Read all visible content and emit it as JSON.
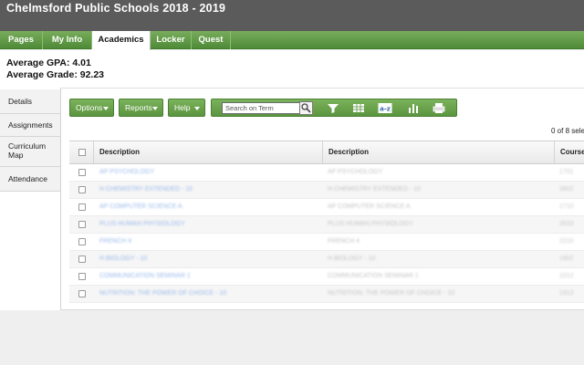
{
  "header": {
    "title": "Chelmsford Public Schools 2018 - 2019"
  },
  "nav": {
    "tabs": [
      {
        "label": "Pages",
        "active": false
      },
      {
        "label": "My Info",
        "active": false
      },
      {
        "label": "Academics",
        "active": true
      },
      {
        "label": "Locker",
        "active": false
      },
      {
        "label": "Quest",
        "active": false
      }
    ]
  },
  "summary": {
    "gpa": "Average GPA: 4.01",
    "grade": "Average Grade: 92.23"
  },
  "sidebar": {
    "items": [
      {
        "label": "Details"
      },
      {
        "label": "Assignments"
      },
      {
        "label": "Curriculum Map"
      },
      {
        "label": "Attendance"
      }
    ]
  },
  "toolbar": {
    "options_label": "Options",
    "reports_label": "Reports",
    "help_label": "Help",
    "search_placeholder": "Search on Term",
    "icons": [
      "search-icon",
      "filter-icon",
      "grid-icon",
      "sort-az-icon",
      "chart-icon",
      "print-icon"
    ]
  },
  "selection": {
    "text": "0 of 8 sele"
  },
  "table": {
    "columns": [
      "Description",
      "Description",
      "Course"
    ],
    "rows": [
      {
        "description": "AP PSYCHOLOGY",
        "description2": "AP PSYCHOLOGY",
        "course": "1701"
      },
      {
        "description": "H CHEMISTRY EXTENDED - 10",
        "description2": "H CHEMISTRY EXTENDED - 10",
        "course": "3802"
      },
      {
        "description": "AP COMPUTER SCIENCE A",
        "description2": "AP COMPUTER SCIENCE A",
        "course": "1710"
      },
      {
        "description": "PLUS HUMAN PHYSIOLOGY",
        "description2": "PLUS HUMAN PHYSIOLOGY",
        "course": "3533"
      },
      {
        "description": "FRENCH 4",
        "description2": "FRENCH 4",
        "course": "2210"
      },
      {
        "description": "H BIOLOGY - 10",
        "description2": "H BIOLOGY - 10",
        "course": "1802"
      },
      {
        "description": "COMMUNICATION SEMINAR 1",
        "description2": "COMMUNICATION SEMINAR 1",
        "course": "1012"
      },
      {
        "description": "NUTRITION: THE POWER OF CHOICE - 10",
        "description2": "NUTRITION: THE POWER OF CHOICE - 10",
        "course": "1913"
      }
    ]
  },
  "colors": {
    "header_bg": "#5b5b5b",
    "nav_green": "#5c953f",
    "link_blue": "#9ab9ec"
  }
}
